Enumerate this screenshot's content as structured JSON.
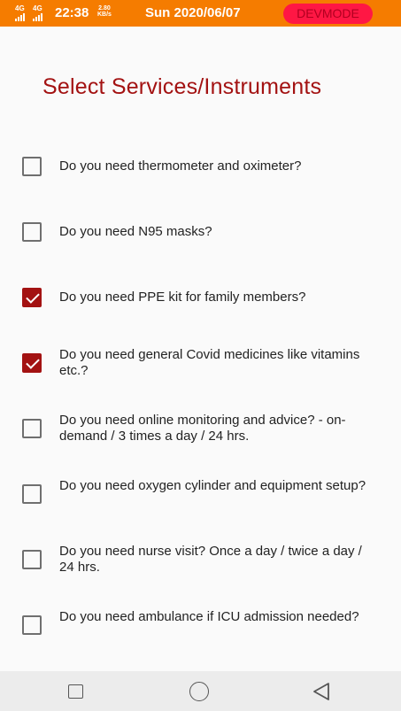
{
  "status_bar": {
    "network_1": "4G",
    "network_2": "4G",
    "time": "22:38",
    "speed_value": "2.80",
    "speed_unit": "KB/s",
    "date": "Sun 2020/06/07",
    "badge": "DEVMODE",
    "badge_color": "#ff1744",
    "bar_color": "#f57c00"
  },
  "page": {
    "title": "Select Services/Instruments",
    "accent_color": "#a31212"
  },
  "options": [
    {
      "label": "Do you need thermometer and oximeter?",
      "checked": false
    },
    {
      "label": "Do you need N95 masks?",
      "checked": false
    },
    {
      "label": "Do you need PPE kit for family members?",
      "checked": true
    },
    {
      "label": "Do you need general Covid medicines like vitamins etc.?",
      "checked": true
    },
    {
      "label": "Do you need online monitoring and advice? - on-demand / 3 times a day / 24 hrs.",
      "checked": false
    },
    {
      "label": "Do you need oxygen cylinder and equipment setup?",
      "checked": false
    },
    {
      "label": "Do you need nurse visit? Once a day / twice a day / 24 hrs.",
      "checked": false
    },
    {
      "label": "Do you need ambulance if ICU admission needed?",
      "checked": false
    }
  ],
  "nav_bar": {
    "icons": [
      "recent-apps-icon",
      "home-icon",
      "back-icon"
    ]
  }
}
